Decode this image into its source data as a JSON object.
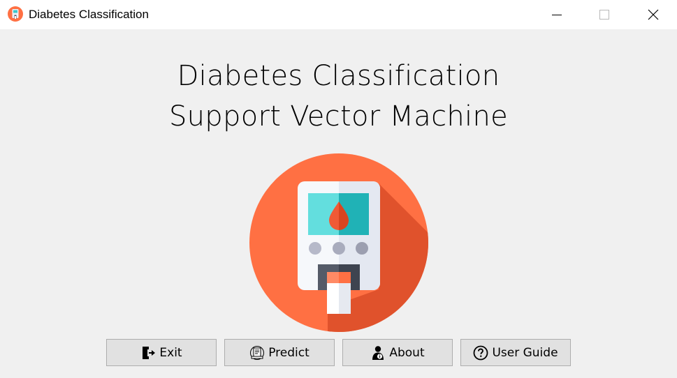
{
  "window": {
    "title": "Diabetes Classification"
  },
  "heading": {
    "line1": "Diabetes Classification",
    "line2": "Support Vector Machine"
  },
  "illustration": {
    "icon": "glucose-meter-icon",
    "colors": {
      "circle": "#ff7043",
      "shadow": "#e0522c",
      "body": "#eef1f6",
      "screen_light": "#63dede",
      "screen_dark": "#20b2b6",
      "drop": "#f05a35",
      "buttons": "#a9acbd",
      "slot": "#464c59",
      "strip_top": "#ff7043"
    }
  },
  "buttons": [
    {
      "label": "Exit",
      "icon": "exit-door-icon"
    },
    {
      "label": "Predict",
      "icon": "report-icon"
    },
    {
      "label": "About",
      "icon": "person-info-icon"
    },
    {
      "label": "User Guide",
      "icon": "question-circle-icon"
    }
  ]
}
